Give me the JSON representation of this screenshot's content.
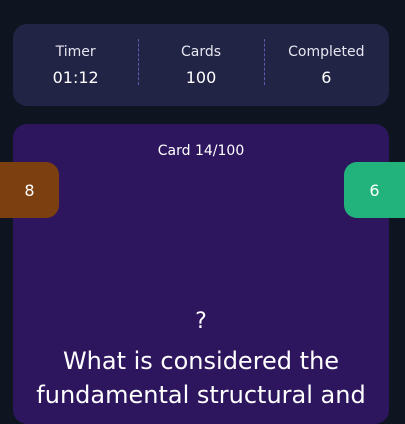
{
  "stats": {
    "timer_label": "Timer",
    "timer_value": "01:12",
    "cards_label": "Cards",
    "cards_value": "100",
    "completed_label": "Completed",
    "completed_value": "6"
  },
  "card": {
    "counter": "Card 14/100",
    "symbol": "?",
    "question": "What is considered the fundamental structural and"
  },
  "side_counts": {
    "left": "8",
    "right": "6"
  },
  "colors": {
    "background": "#0e1420",
    "stats_panel": "#222446",
    "card": "#2e165f",
    "left_badge": "#7c3f10",
    "right_badge": "#22b37d"
  }
}
